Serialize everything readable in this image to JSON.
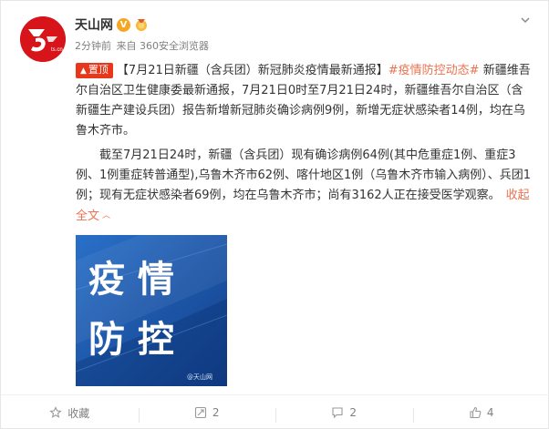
{
  "post": {
    "author": "天山网",
    "verified_icon": "verified-v-icon",
    "medal_icon": "medal-icon",
    "time": "2分钟前",
    "source": "来自 360安全浏览器",
    "top_tag": "置顶",
    "title": "【7月21日新疆（含兵团）新冠肺炎疫情最新通报】",
    "hashtag": "#疫情防控动态#",
    "paragraph1": "新疆维吾尔自治区卫生健康委最新通报，7月21日0时至7月21日24时，新疆维吾尔自治区（含新疆生产建设兵团）报告新增新冠肺炎确诊病例9例，新增无症状感染者14例，均在乌鲁木齐市。",
    "paragraph2": "截至7月21日24时，新疆（含兵团）现有确诊病例64例(其中危重症1例、重症3例、1例重症转普通型),乌鲁木齐市62例、喀什地区1例（乌鲁木齐市输入病例）、兵团1例；现有无症状感染者69例，均在乌鲁木齐市；尚有3162人正在接受医学观察。",
    "collapse_label": "收起全文",
    "image_text_line1": "疫 情",
    "image_text_line2": "防 控",
    "image_watermark": "@天山网"
  },
  "footer": {
    "favorite_label": "收藏",
    "repost_count": "2",
    "comment_count": "2",
    "like_count": "4"
  },
  "colors": {
    "accent": "#eb7350",
    "top_tag_bg": "#e8381b",
    "avatar_bg": "#d8141b",
    "image_bg": "#1d5fb8"
  }
}
